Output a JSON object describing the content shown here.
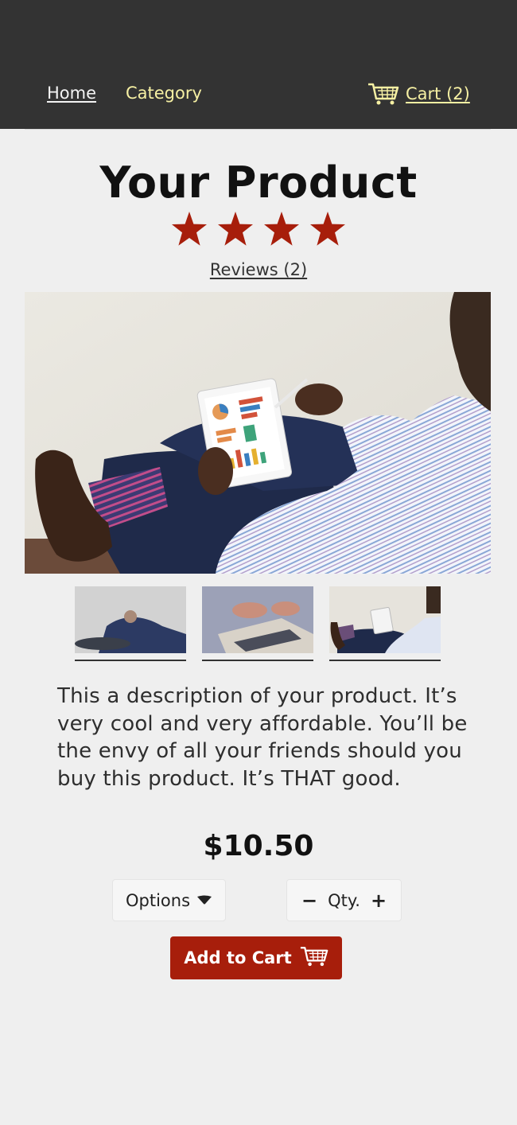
{
  "nav": {
    "home_label": "Home",
    "category_label": "Category",
    "cart_label": "Cart (2)"
  },
  "product": {
    "title": "Your Product",
    "rating": 4,
    "reviews_label": "Reviews (2)",
    "description": "This a description of your product. It’s very cool and very affordable. You’ll be the envy of all your friends should you buy this product. It’s THAT good.",
    "price": "$10.50"
  },
  "controls": {
    "options_label": "Options",
    "qty_label": "Qty.",
    "minus_label": "−",
    "plus_label": "+",
    "add_to_cart_label": "Add to Cart"
  },
  "colors": {
    "header_bg": "#333333",
    "nav_accent": "#f6f0a3",
    "star": "#a71e0b",
    "button_bg": "#a71e0b",
    "page_bg": "#efefef"
  },
  "icons": {
    "cart": "shopping-cart-icon",
    "star": "star-icon",
    "dropdown": "caret-down-icon"
  }
}
